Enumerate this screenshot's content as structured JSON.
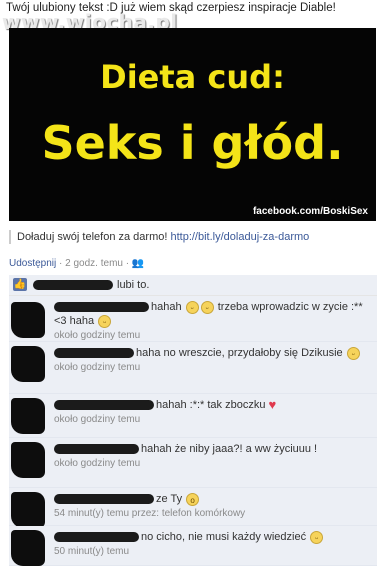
{
  "caption": "Twój ulubiony tekst :D już wiem skąd czerpiesz inspiracje Diable!",
  "watermark": "www.wiocha.pl",
  "poster": {
    "line1": "Dieta cud:",
    "line2": "Seks i głód.",
    "credit": "facebook.com/BoskiSex"
  },
  "promo": {
    "text": "Doładuj swój telefon za darmo! ",
    "link": "http://bit.ly/doladuj-za-darmo"
  },
  "meta": {
    "share": "Udostępnij",
    "time": " · 2 godz. temu · "
  },
  "likes": {
    "text": "lubi to."
  },
  "comments": [
    {
      "text": "hahah",
      "text2": "trzeba wprowadzic w zycie :**<3 haha",
      "time": "około godziny temu"
    },
    {
      "text": "haha no wreszcie, przydałoby się Dzikusie",
      "time": "około godziny temu"
    },
    {
      "text": "hahah :*:* tak zboczku",
      "time": "około godziny temu"
    },
    {
      "text": "hahah że niby jaaa?! a ww życiuuu !",
      "time": "około godziny temu"
    },
    {
      "text": "ze Ty",
      "time": "54 minut(y) temu przez: telefon komórkowy"
    },
    {
      "text": "no cicho, nie musi każdy wiedzieć",
      "time": "50 minut(y) temu"
    }
  ]
}
